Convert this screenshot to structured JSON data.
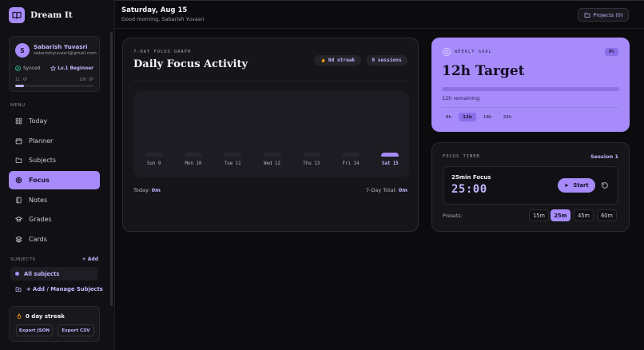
{
  "brand": {
    "name": "Dream It"
  },
  "user": {
    "initial": "S",
    "name": "Sabarish Yuvasri",
    "email": "sabarishyuvasri@gmail.com",
    "sync_status": "Synced",
    "level": "Lv.1 Beginner",
    "xp_current": "11 XP",
    "xp_next": "100 XP",
    "xp_progress": 0.11
  },
  "menu": {
    "title": "MENU",
    "items": [
      {
        "label": "Today",
        "icon": "grid-icon"
      },
      {
        "label": "Planner",
        "icon": "calendar-icon"
      },
      {
        "label": "Subjects",
        "icon": "folder-icon"
      },
      {
        "label": "Focus",
        "icon": "target-icon",
        "active": true
      },
      {
        "label": "Notes",
        "icon": "notebook-icon"
      },
      {
        "label": "Grades",
        "icon": "graduation-cap-icon"
      },
      {
        "label": "Cards",
        "icon": "layers-icon"
      }
    ]
  },
  "subjects": {
    "title": "SUBJECTS",
    "add_label": "+ Add",
    "all_label": "All subjects",
    "manage_label": "+ Add / Manage Subjects"
  },
  "streak_card": {
    "label": "0 day streak",
    "export_json": "Export JSON",
    "export_csv": "Export CSV"
  },
  "header": {
    "date": "Saturday, Aug 15",
    "greeting": "Good morning, Sabarish Yuvasri",
    "projects_label": "Projects (0)"
  },
  "focus_graph": {
    "kicker": "7-DAY FOCUS GRAPH",
    "title": "Daily Focus Activity",
    "streak_pill": "0d streak",
    "sessions_pill": "0 sessions",
    "today_label": "Today:",
    "today_value": "0m",
    "total_label": "7-Day Total:",
    "total_value": "0m"
  },
  "chart_data": {
    "type": "bar",
    "categories": [
      "Sun 9",
      "Mon 10",
      "Tue 11",
      "Wed 12",
      "Thu 13",
      "Fri 14",
      "Sat 15"
    ],
    "values": [
      0,
      0,
      0,
      0,
      0,
      0,
      0
    ],
    "highlighted_category": "Sat 15",
    "title": "Daily Focus Activity",
    "grid": false
  },
  "weekly_goal": {
    "kicker": "WEEKLY GOAL",
    "percent": "0%",
    "progress": 0,
    "title": "12h Target",
    "remaining": "12h remaining",
    "options": [
      {
        "label": "8h"
      },
      {
        "label": "12h",
        "active": true
      },
      {
        "label": "16h"
      },
      {
        "label": "20h"
      }
    ]
  },
  "focus_timer": {
    "kicker": "FOCUS TIMER",
    "session": "Session 1",
    "mode_name": "25min Focus",
    "time": "25:00",
    "start_label": "Start",
    "presets_label": "Presets:",
    "presets": [
      {
        "label": "15m"
      },
      {
        "label": "25m",
        "active": true
      },
      {
        "label": "45m"
      },
      {
        "label": "60m"
      }
    ]
  },
  "colors": {
    "accent": "#a78bfa",
    "accent_text": "#c4b5fd",
    "background": "#0c0c0f",
    "card": "#15151a"
  }
}
